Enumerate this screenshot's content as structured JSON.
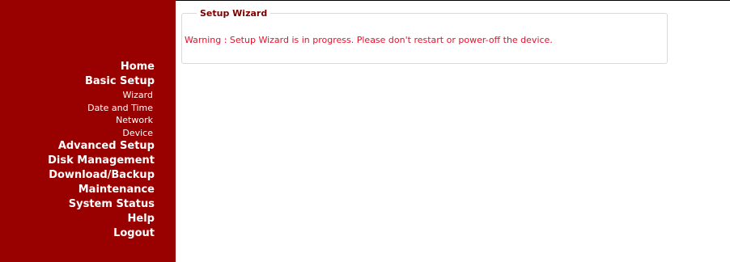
{
  "sidebar": {
    "items": [
      {
        "label": "Home",
        "level": "main"
      },
      {
        "label": "Basic Setup",
        "level": "main"
      },
      {
        "label": "Wizard",
        "level": "sub"
      },
      {
        "label": "Date and Time",
        "level": "sub"
      },
      {
        "label": "Network",
        "level": "sub"
      },
      {
        "label": "Device",
        "level": "sub"
      },
      {
        "label": "Advanced Setup",
        "level": "main"
      },
      {
        "label": "Disk Management",
        "level": "main"
      },
      {
        "label": "Download/Backup",
        "level": "main"
      },
      {
        "label": "Maintenance",
        "level": "main"
      },
      {
        "label": "System Status",
        "level": "main"
      },
      {
        "label": "Help",
        "level": "main"
      },
      {
        "label": "Logout",
        "level": "main"
      }
    ]
  },
  "wizard": {
    "title": "Setup Wizard",
    "warning": "Warning : Setup Wizard is in progress. Please don't restart or power-off the device."
  },
  "colors": {
    "sidebar_bg": "#990000",
    "legend_text": "#7a0000",
    "warning_text": "#e8102a"
  }
}
